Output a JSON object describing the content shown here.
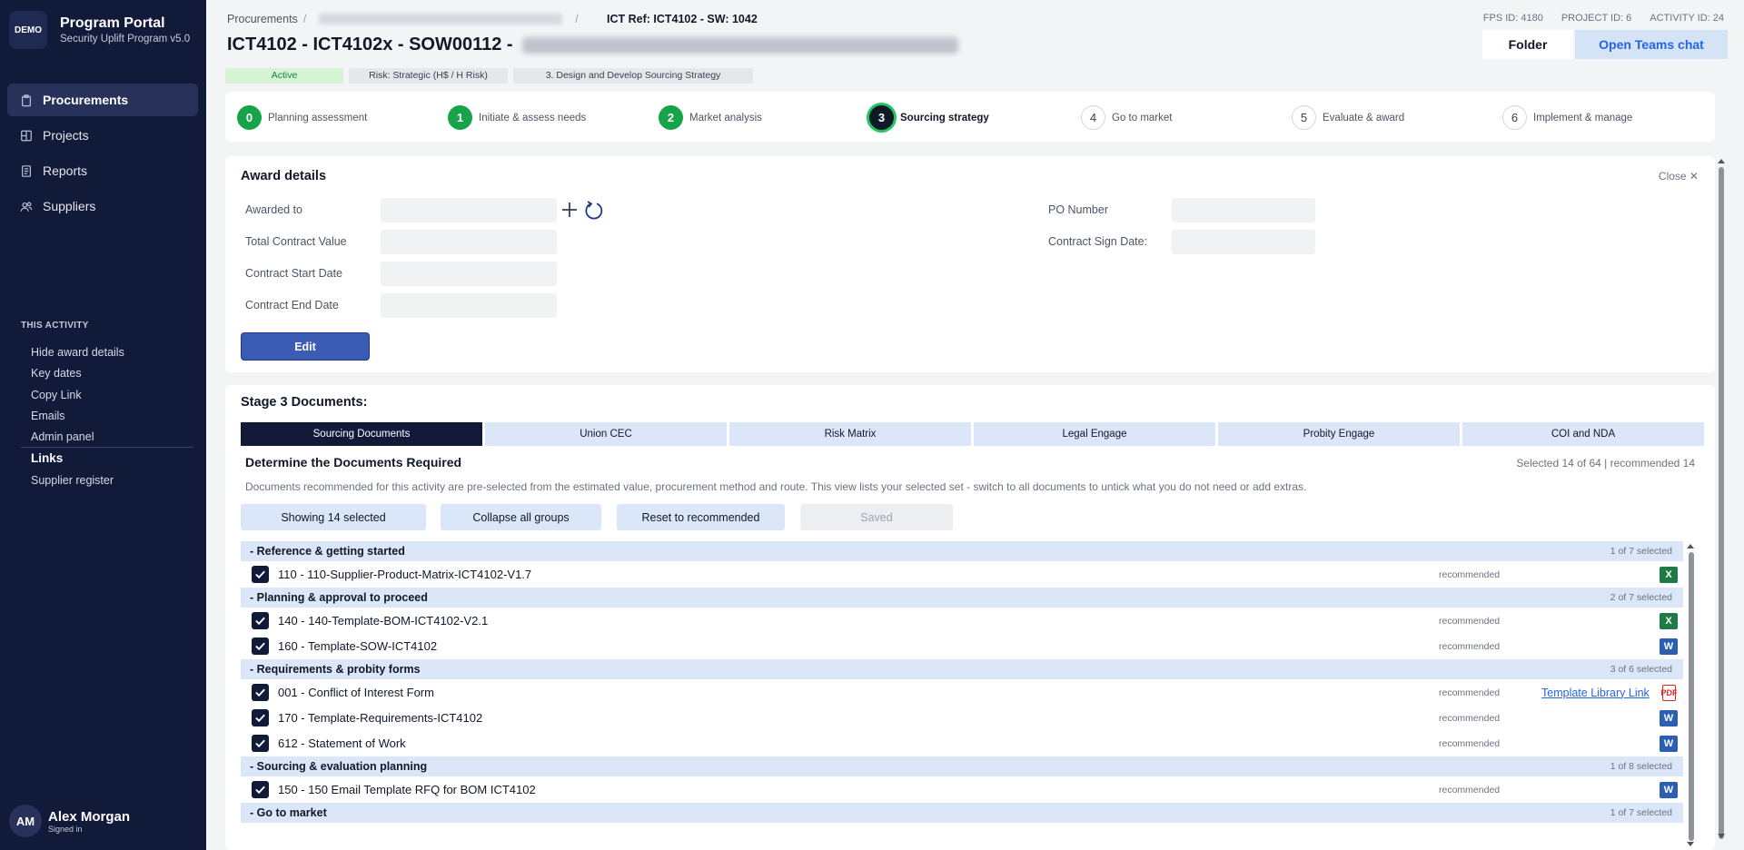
{
  "sidebar": {
    "brand_badge": "DEMO",
    "brand_title": "Program Portal",
    "brand_subtitle": "Security Uplift Program v5.0",
    "nav": [
      {
        "label": "Procurements",
        "icon": "clipboard-icon",
        "active": true
      },
      {
        "label": "Projects",
        "icon": "grid-icon",
        "active": false
      },
      {
        "label": "Reports",
        "icon": "document-icon",
        "active": false
      },
      {
        "label": "Suppliers",
        "icon": "users-icon",
        "active": false
      }
    ],
    "activity_title": "THIS ACTIVITY",
    "activity_links": [
      "Hide award details",
      "Key dates",
      "Copy Link",
      "Emails",
      "Admin panel"
    ],
    "links_title": "Links",
    "links_items": [
      "Supplier register"
    ],
    "user": {
      "initials": "AM",
      "name": "Alex Morgan",
      "status": "Signed in"
    }
  },
  "header": {
    "breadcrumb_root": "Procurements",
    "breadcrumb_sep": "/",
    "ict_ref": "ICT Ref: ICT4102 - SW: 1042",
    "fps_id": "FPS ID: 4180",
    "project_id": "PROJECT ID: 6",
    "activity_id": "ACTIVITY ID: 24",
    "title": "ICT4102 - ICT4102x - SOW00112 -",
    "folder_label": "Folder",
    "teams_label": "Open Teams chat",
    "tags": {
      "status": "Active",
      "risk": "Risk: Strategic (H$ / H Risk)",
      "stage": "3. Design and Develop Sourcing Strategy"
    }
  },
  "steps": [
    {
      "num": "0",
      "label": "Planning assessment",
      "state": "done"
    },
    {
      "num": "1",
      "label": "Initiate & assess needs",
      "state": "done"
    },
    {
      "num": "2",
      "label": "Market analysis",
      "state": "done"
    },
    {
      "num": "3",
      "label": "Sourcing strategy",
      "state": "current"
    },
    {
      "num": "4",
      "label": "Go to market",
      "state": "todo"
    },
    {
      "num": "5",
      "label": "Evaluate & award",
      "state": "todo"
    },
    {
      "num": "6",
      "label": "Implement & manage",
      "state": "todo"
    }
  ],
  "award": {
    "title": "Award details",
    "close_label": "Close ✕",
    "awarded_to_label": "Awarded to",
    "total_value_label": "Total Contract Value",
    "start_date_label": "Contract Start Date",
    "end_date_label": "Contract End Date",
    "po_number_label": "PO Number",
    "sign_date_label": "Contract Sign Date:",
    "edit_label": "Edit"
  },
  "docs": {
    "title": "Stage 3 Documents:",
    "tabs": [
      "Sourcing Documents",
      "Union CEC",
      "Risk Matrix",
      "Legal Engage",
      "Probity Engage",
      "COI and NDA"
    ],
    "subtitle": "Determine the Documents Required",
    "count_text": "Selected 14 of 64   |   recommended 14",
    "description": "Documents recommended for this activity are pre-selected from the estimated value, procurement method and route. This view lists your selected set - switch to all documents to untick what you do not need or add extras.",
    "buttons": {
      "showing": "Showing 14 selected",
      "collapse": "Collapse all groups",
      "reset": "Reset to recommended",
      "saved": "Saved"
    },
    "groups": [
      {
        "label": "-  Reference & getting started",
        "count": "1 of 7 selected",
        "items": [
          {
            "name": "110 - 110-Supplier-Product-Matrix-ICT4102-V1.7",
            "rec": "recommended",
            "type": "xlsx",
            "type_icon": "X"
          }
        ]
      },
      {
        "label": "-  Planning & approval to proceed",
        "count": "2 of 7 selected",
        "items": [
          {
            "name": "140 - 140-Template-BOM-ICT4102-V2.1",
            "rec": "recommended",
            "type": "xlsx",
            "type_icon": "X"
          },
          {
            "name": "160 - Template-SOW-ICT4102",
            "rec": "recommended",
            "type": "docx",
            "type_icon": "W"
          }
        ]
      },
      {
        "label": "-  Requirements & probity forms",
        "count": "3 of 6 selected",
        "items": [
          {
            "name": "001 - Conflict of Interest Form",
            "rec": "recommended",
            "type": "pdf",
            "type_icon": "PDF",
            "template_link": "Template Library Link"
          },
          {
            "name": "170 - Template-Requirements-ICT4102",
            "rec": "recommended",
            "type": "docx",
            "type_icon": "W"
          },
          {
            "name": "612 - Statement of Work",
            "rec": "recommended",
            "type": "docx",
            "type_icon": "W"
          }
        ]
      },
      {
        "label": "-  Sourcing & evaluation planning",
        "count": "1 of 8 selected",
        "items": [
          {
            "name": "150 - 150 Email Template RFQ for BOM ICT4102",
            "rec": "recommended",
            "type": "docx",
            "type_icon": "W"
          }
        ]
      },
      {
        "label": "-  Go to market",
        "count": "1 of 7 selected",
        "items": []
      }
    ]
  }
}
